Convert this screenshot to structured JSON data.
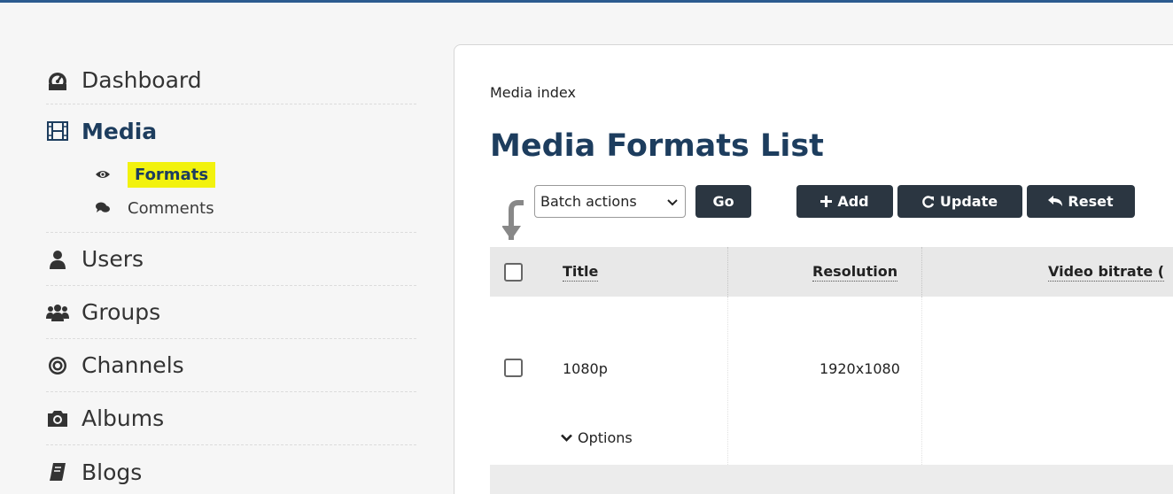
{
  "sidebar": {
    "items": [
      {
        "label": "Dashboard",
        "icon": "dashboard-icon"
      },
      {
        "label": "Media",
        "icon": "film-icon"
      },
      {
        "label": "Users",
        "icon": "user-icon"
      },
      {
        "label": "Groups",
        "icon": "users-group-icon"
      },
      {
        "label": "Channels",
        "icon": "bullseye-icon"
      },
      {
        "label": "Albums",
        "icon": "camera-icon"
      },
      {
        "label": "Blogs",
        "icon": "book-icon"
      }
    ],
    "media_sub": [
      {
        "label": "Formats",
        "icon": "eye-icon",
        "active": true
      },
      {
        "label": "Comments",
        "icon": "comments-icon"
      }
    ]
  },
  "panel": {
    "breadcrumb": "Media index",
    "title": "Media Formats List"
  },
  "toolbar": {
    "batch_select_value": "Batch actions",
    "go_label": "Go",
    "add_label": "Add",
    "update_label": "Update",
    "reset_label": "Reset"
  },
  "table": {
    "columns": [
      "Title",
      "Resolution",
      "Video bitrate ("
    ],
    "rows": [
      {
        "title": "1080p",
        "resolution": "1920x1080",
        "options_label": "Options"
      }
    ]
  },
  "colors": {
    "accent": "#1d3d5e",
    "button_bg": "#2b3641",
    "highlight": "#f2f20e",
    "top_bar": "#2c5b8f"
  }
}
